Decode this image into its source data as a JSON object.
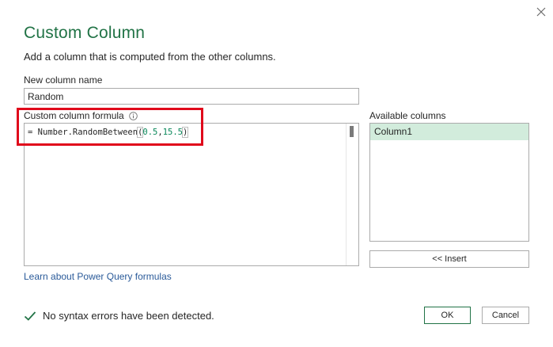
{
  "dialog": {
    "title": "Custom Column",
    "subtitle": "Add a column that is computed from the other columns."
  },
  "new_column": {
    "label": "New column name",
    "value": "Random"
  },
  "formula": {
    "label": "Custom column formula",
    "prefix": "= Number.RandomBetween",
    "open_paren": "(",
    "arg1": "0.5",
    "comma": ",",
    "arg2": "15.5",
    "close_paren": ")"
  },
  "available_columns": {
    "label": "Available columns",
    "items": [
      "Column1"
    ]
  },
  "buttons": {
    "insert": "<< Insert",
    "ok": "OK",
    "cancel": "Cancel"
  },
  "learn_link": "Learn about Power Query formulas",
  "status_message": "No syntax errors have been detected.",
  "colors": {
    "accent": "#217346",
    "highlight": "#e0081b",
    "selected_item": "#d2ecdc",
    "link": "#2a5a99"
  },
  "icons": {
    "close": "close-icon",
    "info": "info-icon",
    "check": "check-icon"
  }
}
